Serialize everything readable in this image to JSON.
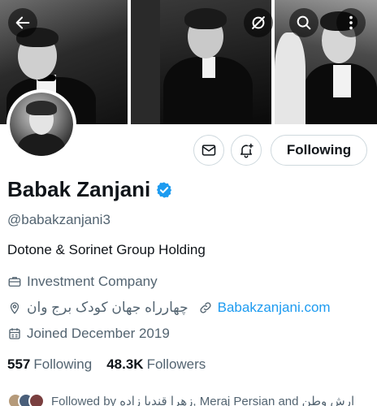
{
  "profile": {
    "name": "Babak Zanjani",
    "handle": "@babakzanjani3",
    "bio": "Dotone & Sorinet Group Holding",
    "category": "Investment Company",
    "location": "چهارراه جهان کودک برج وان",
    "website": "Babakzanjani.com",
    "joined": "Joined December 2019"
  },
  "actions": {
    "following_label": "Following"
  },
  "stats": {
    "following_count": "557",
    "following_label": "Following",
    "followers_count": "48.3K",
    "followers_label": "Followers"
  },
  "followed_by": {
    "text": "Followed by زهرا قندیا زاده, Meraj Persian and ارش وطن"
  },
  "icons": {
    "back": "back-arrow-icon",
    "circle_slash": "circle-slash-icon",
    "search": "search-icon",
    "more": "more-vertical-icon",
    "message": "envelope-icon",
    "notify": "bell-plus-icon",
    "verified": "verified-badge-icon",
    "category": "briefcase-icon",
    "location": "location-pin-icon",
    "link": "link-icon",
    "calendar": "calendar-icon"
  },
  "colors": {
    "accent": "#1d9bf0",
    "text_primary": "#0f1419",
    "text_secondary": "#536471",
    "border": "#cfd9de"
  }
}
